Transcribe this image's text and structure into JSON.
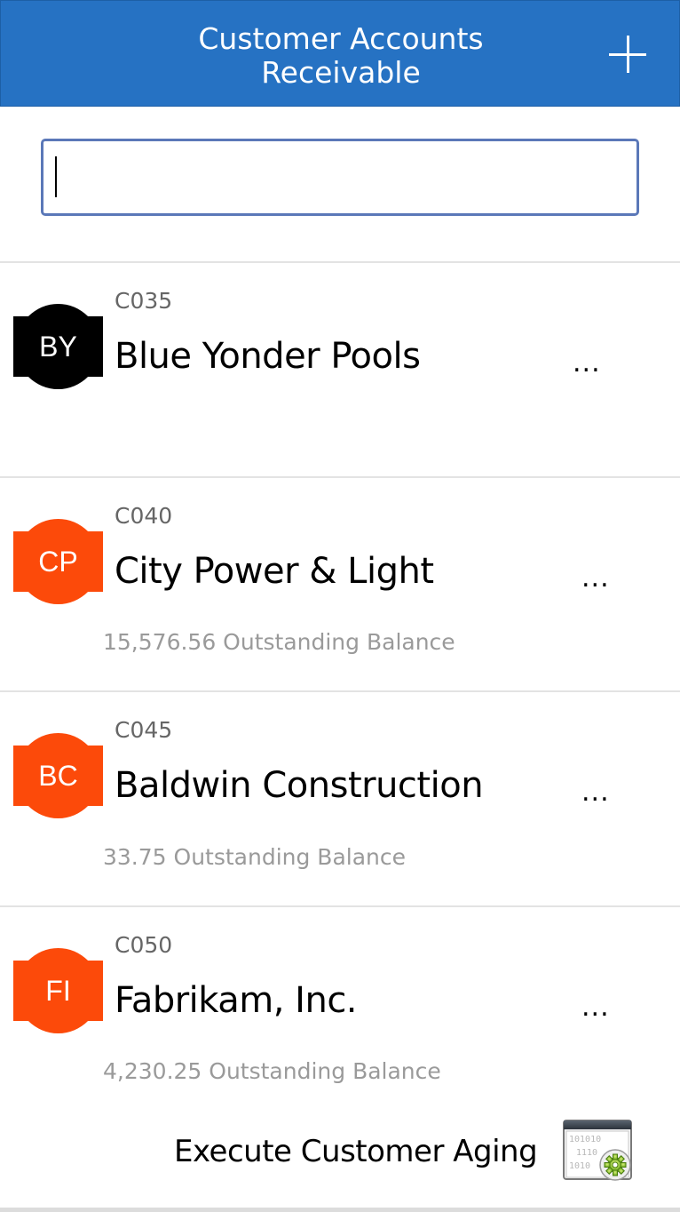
{
  "header": {
    "title_line1": "Customer Accounts",
    "title_line2": "Receivable",
    "add_icon": "plus-icon"
  },
  "search": {
    "value": "",
    "placeholder": ""
  },
  "customers": [
    {
      "code": "C035",
      "initials": "BY",
      "name": "Blue Yonder Pools",
      "balance_text": "",
      "avatar_color": "#000000",
      "more": "..."
    },
    {
      "code": "C040",
      "initials": "CP",
      "name": "City Power & Light",
      "balance_text": "15,576.56 Outstanding Balance",
      "avatar_color": "#fc4a0a",
      "more": "..."
    },
    {
      "code": "C045",
      "initials": "BC",
      "name": "Baldwin Construction",
      "balance_text": "33.75 Outstanding Balance",
      "avatar_color": "#fc4a0a",
      "more": "..."
    },
    {
      "code": "C050",
      "initials": "FI",
      "name": "Fabrikam, Inc.",
      "balance_text": "4,230.25 Outstanding Balance",
      "avatar_color": "#fc4a0a",
      "more": "..."
    }
  ],
  "footer": {
    "action_label": "Execute Customer Aging",
    "action_icon": "binary-settings-icon"
  },
  "colors": {
    "header_bg": "#2672c3",
    "accent_orange": "#fc4a0a",
    "search_border": "#5b78b8"
  }
}
